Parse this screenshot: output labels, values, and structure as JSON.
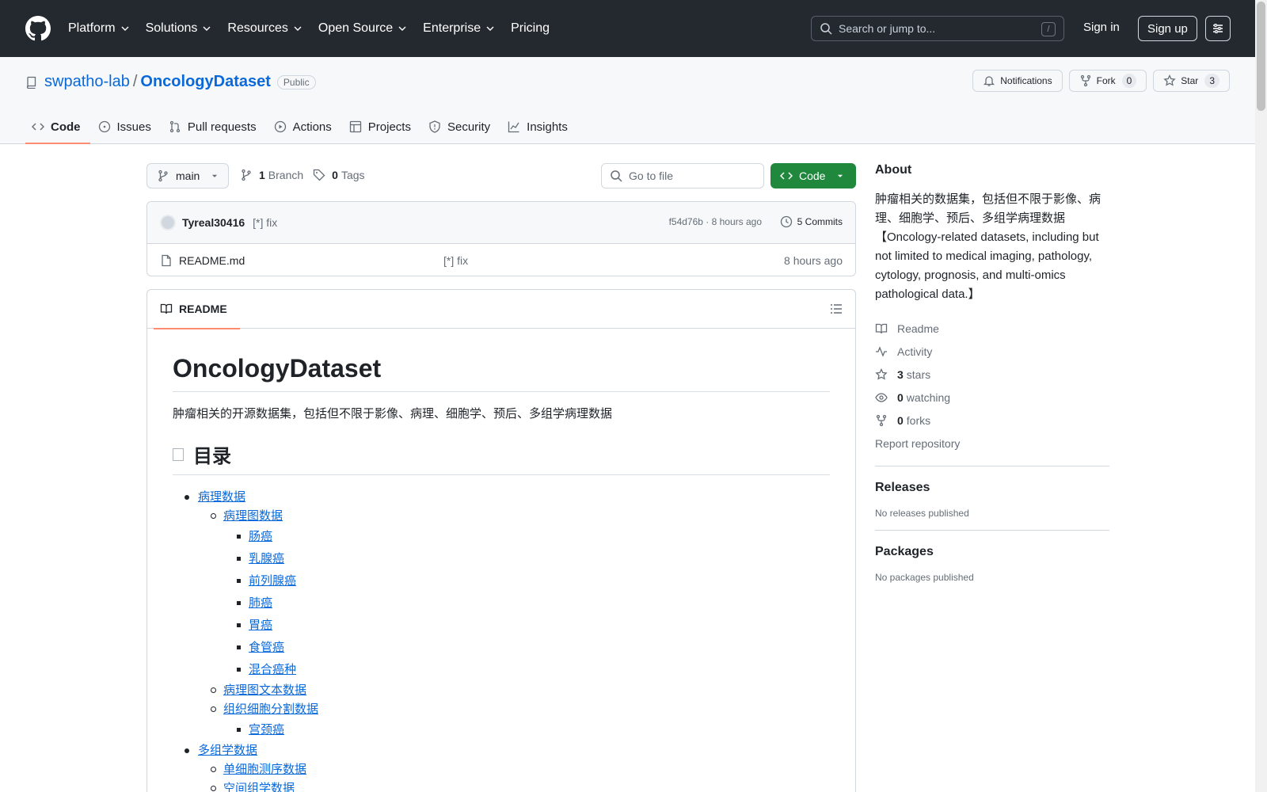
{
  "header": {
    "nav": [
      "Platform",
      "Solutions",
      "Resources",
      "Open Source",
      "Enterprise",
      "Pricing"
    ],
    "search_placeholder": "Search or jump to...",
    "search_shortcut": "/",
    "sign_in": "Sign in",
    "sign_up": "Sign up"
  },
  "repo": {
    "owner": "swpatho-lab",
    "separator": "/",
    "name": "OncologyDataset",
    "visibility": "Public",
    "notifications_label": "Notifications",
    "fork_label": "Fork",
    "fork_count": "0",
    "star_label": "Star",
    "star_count": "3",
    "tabs": [
      "Code",
      "Issues",
      "Pull requests",
      "Actions",
      "Projects",
      "Security",
      "Insights"
    ]
  },
  "branch": {
    "name": "main",
    "branch_count": "1",
    "branch_label": "Branch",
    "tag_count": "0",
    "tag_label": "Tags",
    "goto_placeholder": "Go to file",
    "code_button": "Code"
  },
  "commit": {
    "author": "Tyreal30416",
    "message": "[*] fix",
    "meta": "f54d76b · 8 hours ago",
    "commits": "5 Commits"
  },
  "files": [
    {
      "name": "README.md",
      "message": "[*] fix",
      "time": "8 hours ago"
    }
  ],
  "readme": {
    "tab": "README",
    "title": "OncologyDataset",
    "intro": "肿瘤相关的开源数据集，包括但不限于影像、病理、细胞学、预后、多组学病理数据",
    "toc_heading": "目录",
    "toc": [
      {
        "level": 1,
        "text": "病理数据"
      },
      {
        "level": 2,
        "text": "病理图数据"
      },
      {
        "level": 3,
        "text": "肠癌"
      },
      {
        "level": 3,
        "text": "乳腺癌"
      },
      {
        "level": 3,
        "text": "前列腺癌"
      },
      {
        "level": 3,
        "text": "肺癌"
      },
      {
        "level": 3,
        "text": "胃癌"
      },
      {
        "level": 3,
        "text": "食管癌"
      },
      {
        "level": 3,
        "text": "混合癌种"
      },
      {
        "level": 2,
        "text": "病理图文本数据"
      },
      {
        "level": 2,
        "text": "组织细胞分割数据"
      },
      {
        "level": 3,
        "text": "宫颈癌"
      },
      {
        "level": 1,
        "text": "多组学数据"
      },
      {
        "level": 2,
        "text": "单细胞测序数据"
      },
      {
        "level": 2,
        "text": "空间组学数据"
      }
    ]
  },
  "sidebar": {
    "about_heading": "About",
    "about_text": "肿瘤相关的数据集，包括但不限于影像、病理、细胞学、预后、多组学病理数据【Oncology-related datasets, including but not limited to medical imaging, pathology, cytology, prognosis, and multi-omics pathological data.】",
    "readme": "Readme",
    "activity": "Activity",
    "stars_count": "3",
    "stars_label": "stars",
    "watching_count": "0",
    "watching_label": "watching",
    "forks_count": "0",
    "forks_label": "forks",
    "report": "Report repository",
    "releases_heading": "Releases",
    "releases_text": "No releases published",
    "packages_heading": "Packages",
    "packages_text": "No packages published"
  }
}
